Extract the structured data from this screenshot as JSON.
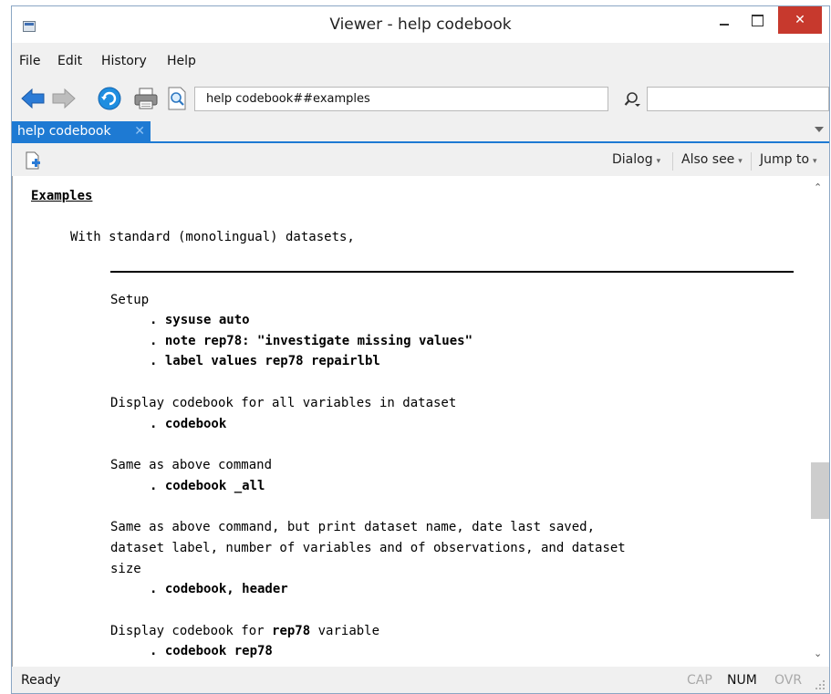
{
  "window": {
    "title": "Viewer - help codebook"
  },
  "titlebar": {
    "close_glyph": "✕"
  },
  "menu": {
    "items": [
      "File",
      "Edit",
      "History",
      "Help"
    ]
  },
  "toolbar": {
    "address": "help codebook##examples",
    "find_placeholder": ""
  },
  "tabs": [
    {
      "label": "help codebook",
      "close_glyph": "✕"
    }
  ],
  "viewer_toolbar": {
    "dialog": "Dialog",
    "also_see": "Also see",
    "jump_to": "Jump to",
    "caret": "▾"
  },
  "content": {
    "heading": "Examples",
    "intro": "With standard (monolingual) datasets,",
    "setup_label": "Setup",
    "setup_cmds": [
      ". sysuse auto",
      ". note rep78: \"investigate missing values\"",
      ". label values rep78 repairlbl"
    ],
    "ex1_label": "Display codebook for all variables in dataset",
    "ex1_cmd": ". codebook",
    "ex2_label": "Same as above command",
    "ex2_cmd": ". codebook _all",
    "ex3_label_lines": [
      "Same as above command, but print dataset name, date last saved,",
      "dataset label, number of variables and of observations, and dataset",
      "size"
    ],
    "ex3_cmd": ". codebook, header",
    "ex4_label_prefix": "Display codebook for ",
    "ex4_label_bold": "rep78",
    "ex4_label_suffix": " variable",
    "ex4_cmd": ". codebook rep78"
  },
  "scrollbar": {
    "up_glyph": "⌃",
    "down_glyph": "⌄",
    "position": 0.6
  },
  "status": {
    "text": "Ready",
    "indicators": [
      {
        "label": "CAP",
        "active": false
      },
      {
        "label": "NUM",
        "active": true
      },
      {
        "label": "OVR",
        "active": false
      }
    ]
  },
  "colors": {
    "tab_active": "#1e7ad3",
    "close_button": "#c7392d",
    "back_arrow": "#2b7bd6",
    "forward_arrow": "#bdbdbd",
    "refresh": "#1f8ee0"
  },
  "icons": [
    "back-arrow-icon",
    "forward-arrow-icon",
    "refresh-icon",
    "print-icon",
    "find-in-page-icon",
    "search-icon",
    "new-viewer-icon"
  ]
}
